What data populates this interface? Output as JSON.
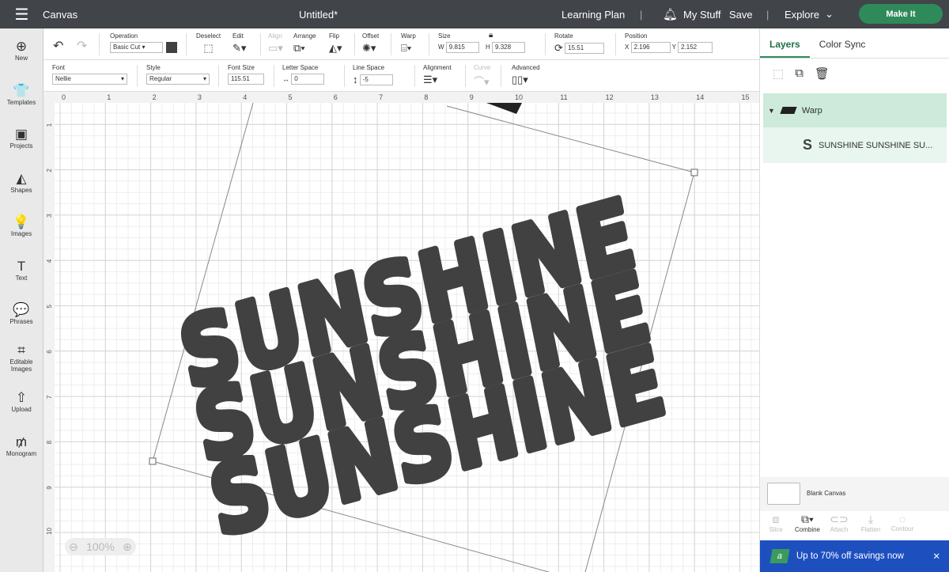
{
  "topbar": {
    "app": "Canvas",
    "title": "Untitled*",
    "learning": "Learning Plan",
    "mystuff": "My Stuff",
    "save": "Save",
    "explore": "Explore",
    "makeit": "Make It"
  },
  "sidebar": [
    {
      "icon": "plus-icon",
      "glyph": "⊕",
      "label": "New"
    },
    {
      "icon": "shirt-icon",
      "glyph": "👕",
      "label": "Templates"
    },
    {
      "icon": "projects-icon",
      "glyph": "▣",
      "label": "Projects"
    },
    {
      "icon": "shapes-icon",
      "glyph": "◭",
      "label": "Shapes"
    },
    {
      "icon": "lightbulb-icon",
      "glyph": "💡",
      "label": "Images"
    },
    {
      "icon": "text-icon",
      "glyph": "T",
      "label": "Text"
    },
    {
      "icon": "speech-bubble-icon",
      "glyph": "💬",
      "label": "Phrases"
    },
    {
      "icon": "editable-images-icon",
      "glyph": "⌗",
      "label": "Editable Images"
    },
    {
      "icon": "upload-icon",
      "glyph": "⇧",
      "label": "Upload"
    },
    {
      "icon": "monogram-icon",
      "glyph": "₥",
      "label": "Monogram"
    }
  ],
  "toolbar1": {
    "operation_label": "Operation",
    "operation": "Basic Cut",
    "color": "#414141",
    "deselect": "Deselect",
    "edit": "Edit",
    "align": "Align",
    "arrange": "Arrange",
    "flip": "Flip",
    "offset": "Offset",
    "warp": "Warp",
    "size": "Size",
    "w_label": "W",
    "w": "9.815",
    "h_label": "H",
    "h": "9.328",
    "rotate": "Rotate",
    "rotate_val": "15.51",
    "position": "Position",
    "x_label": "X",
    "x": "2.196",
    "y_label": "Y",
    "y": "2.152"
  },
  "toolbar2": {
    "font_label": "Font",
    "font": "Nellie",
    "style_label": "Style",
    "style": "Regular",
    "font_size_label": "Font Size",
    "font_size": "115.51",
    "letter_space_label": "Letter Space",
    "letter_space": "0",
    "line_space_label": "Line Space",
    "line_space": "-5",
    "alignment": "Alignment",
    "curve": "Curve",
    "advanced": "Advanced"
  },
  "ruler": {
    "x": [
      "0",
      "1",
      "2",
      "3",
      "4",
      "5",
      "6",
      "7",
      "8",
      "9",
      "10",
      "11",
      "12",
      "13",
      "14",
      "15"
    ],
    "y": [
      "1",
      "2",
      "3",
      "4",
      "5",
      "6",
      "7",
      "8",
      "9",
      "10"
    ]
  },
  "design": {
    "lines": [
      "SUNSHINE",
      "SUNSHINE",
      "SUNSHINE"
    ],
    "fill": "#414141",
    "rotation_deg": 15.51
  },
  "zoom": {
    "value": "100%"
  },
  "panel": {
    "tabs": [
      "Layers",
      "Color Sync"
    ],
    "group": "Warp",
    "layer": "SUNSHINE SUNSHINE SU...",
    "blank": "Blank Canvas",
    "actions": [
      "Slice",
      "Combine",
      "Attach",
      "Flatten",
      "Contour"
    ],
    "promo": "Up to 70% off savings now",
    "accent": "#2f8a5a",
    "promo_bg": "#1d4fbf"
  }
}
